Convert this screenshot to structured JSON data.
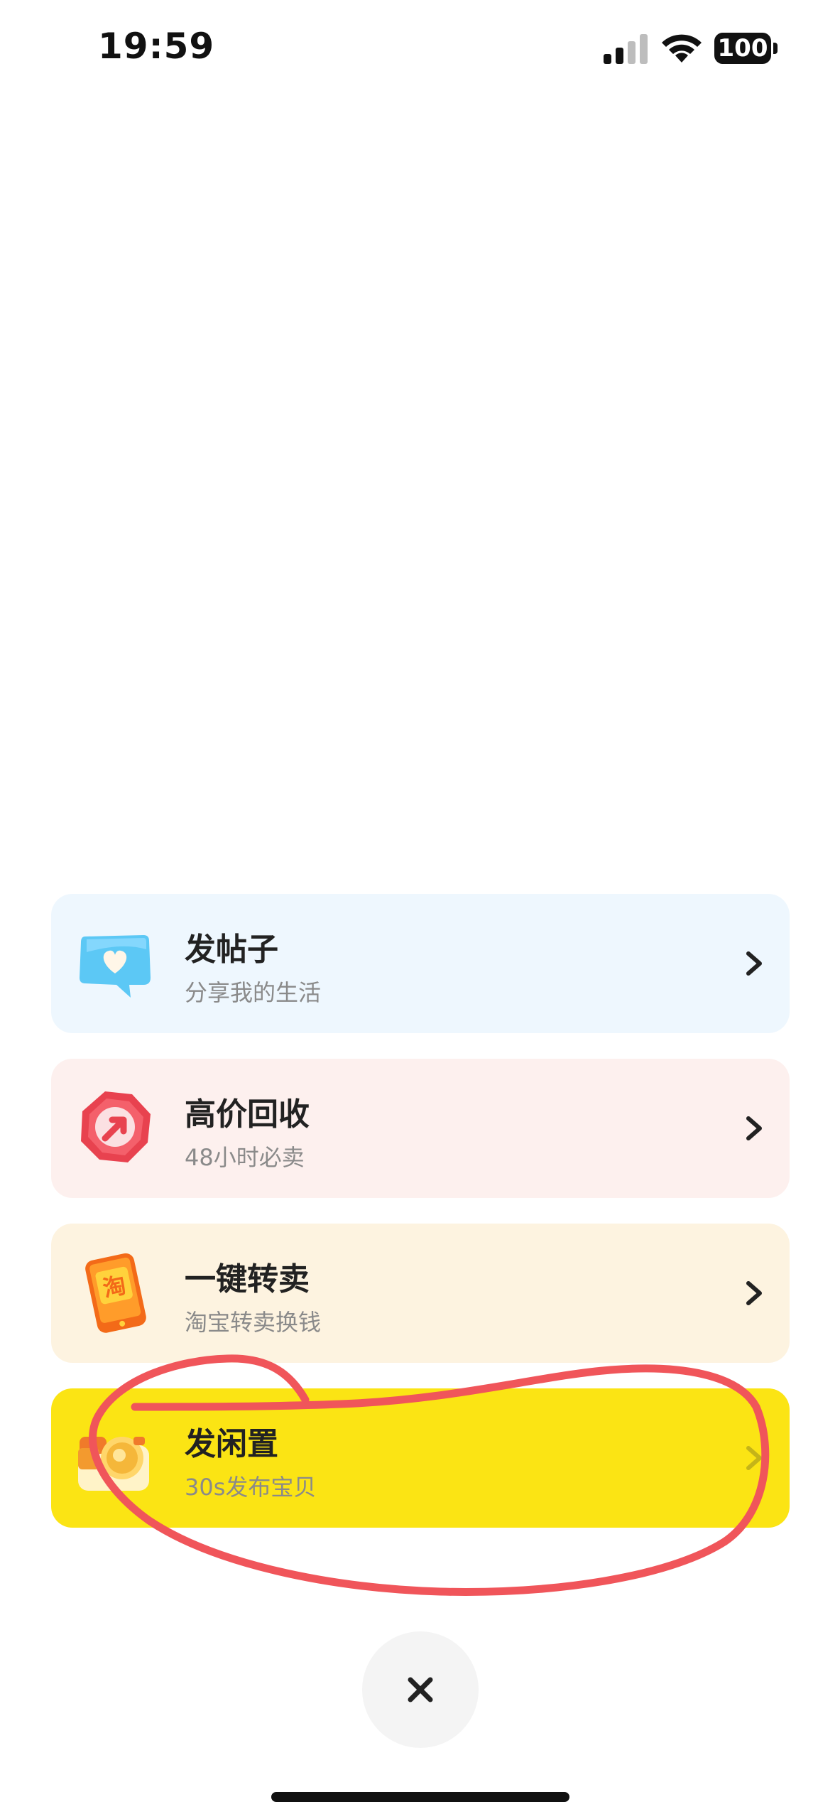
{
  "status_bar": {
    "time": "19:59",
    "battery": "100",
    "icons": [
      "signal-icon",
      "wifi-icon",
      "battery-icon"
    ]
  },
  "menu": {
    "items": [
      {
        "title": "发帖子",
        "subtitle": "分享我的生活",
        "icon": "heart-bubble-icon",
        "bg": "#eef7fe"
      },
      {
        "title": "高价回收",
        "subtitle": "48小时必卖",
        "icon": "arrow-badge-icon",
        "bg": "#fdf0ee"
      },
      {
        "title": "一键转卖",
        "subtitle": "淘宝转卖换钱",
        "icon": "taobao-phone-icon",
        "icon_text": "淘",
        "bg": "#fdf3e0"
      },
      {
        "title": "发闲置",
        "subtitle": "30s发布宝贝",
        "icon": "camera-icon",
        "bg": "#fbe414"
      }
    ]
  },
  "annotation": {
    "color": "#f0555a"
  },
  "close": {
    "icon": "close-icon"
  }
}
